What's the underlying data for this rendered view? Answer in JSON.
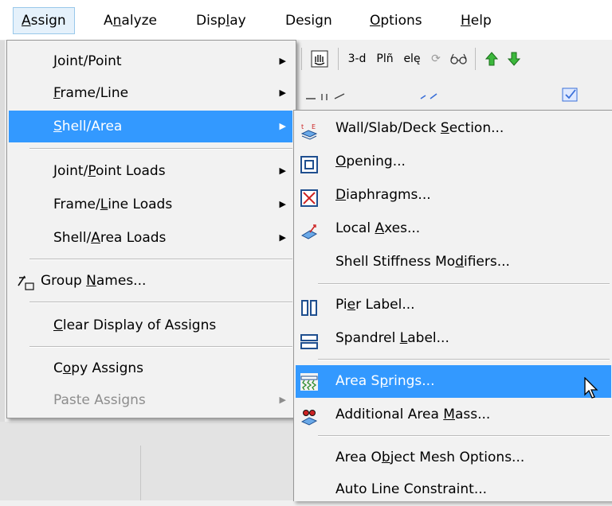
{
  "menubar": {
    "items": [
      {
        "pre": "",
        "u": "A",
        "post": "ssign"
      },
      {
        "pre": "A",
        "u": "n",
        "post": "alyze"
      },
      {
        "pre": "Disp",
        "u": "l",
        "post": "ay"
      },
      {
        "pre": "Desi",
        "u": "g",
        "post": "n"
      },
      {
        "pre": "",
        "u": "O",
        "post": "ptions"
      },
      {
        "pre": "",
        "u": "H",
        "post": "elp"
      }
    ]
  },
  "toolbar": {
    "three_d_label": "3-d",
    "plan_label": "Plñ",
    "elev_label": "elę"
  },
  "assign_menu": {
    "items": [
      {
        "pre": "",
        "u": "J",
        "post": "oint/Point"
      },
      {
        "pre": "",
        "u": "F",
        "post": "rame/Line"
      },
      {
        "pre": "",
        "u": "S",
        "post": "hell/Area"
      },
      {
        "pre": "Joint/",
        "u": "P",
        "post": "oint Loads"
      },
      {
        "pre": "Frame/",
        "u": "L",
        "post": "ine Loads"
      },
      {
        "pre": "Shell/",
        "u": "A",
        "post": "rea Loads"
      },
      {
        "pre": "Group ",
        "u": "N",
        "post": "ames..."
      },
      {
        "pre": "",
        "u": "C",
        "post": "lear Display of Assigns"
      },
      {
        "pre": "C",
        "u": "o",
        "post": "py Assigns"
      },
      {
        "pre": "Paste Assi",
        "u": "g",
        "post": "ns"
      }
    ]
  },
  "shell_area_menu": {
    "items": [
      {
        "pre": "Wall/Slab/Deck ",
        "u": "S",
        "post": "ection..."
      },
      {
        "pre": "",
        "u": "O",
        "post": "pening..."
      },
      {
        "pre": "",
        "u": "D",
        "post": "iaphragms..."
      },
      {
        "pre": "Local ",
        "u": "A",
        "post": "xes..."
      },
      {
        "pre": "Shell Stiffness Mo",
        "u": "d",
        "post": "ifiers..."
      },
      {
        "pre": "Pi",
        "u": "e",
        "post": "r Label..."
      },
      {
        "pre": "Spandrel ",
        "u": "L",
        "post": "abel..."
      },
      {
        "pre": "Area S",
        "u": "p",
        "post": "rings..."
      },
      {
        "pre": "Additional Area ",
        "u": "M",
        "post": "ass..."
      },
      {
        "pre": "Area O",
        "u": "b",
        "post": "ject Mesh Options..."
      },
      {
        "pre": "Auto Line Constraint",
        "u": "",
        "post": "..."
      }
    ]
  },
  "colors": {
    "highlight": "#3399ff",
    "menu_bg": "#f2f2f2",
    "disabled_text": "#8d8d8d"
  }
}
